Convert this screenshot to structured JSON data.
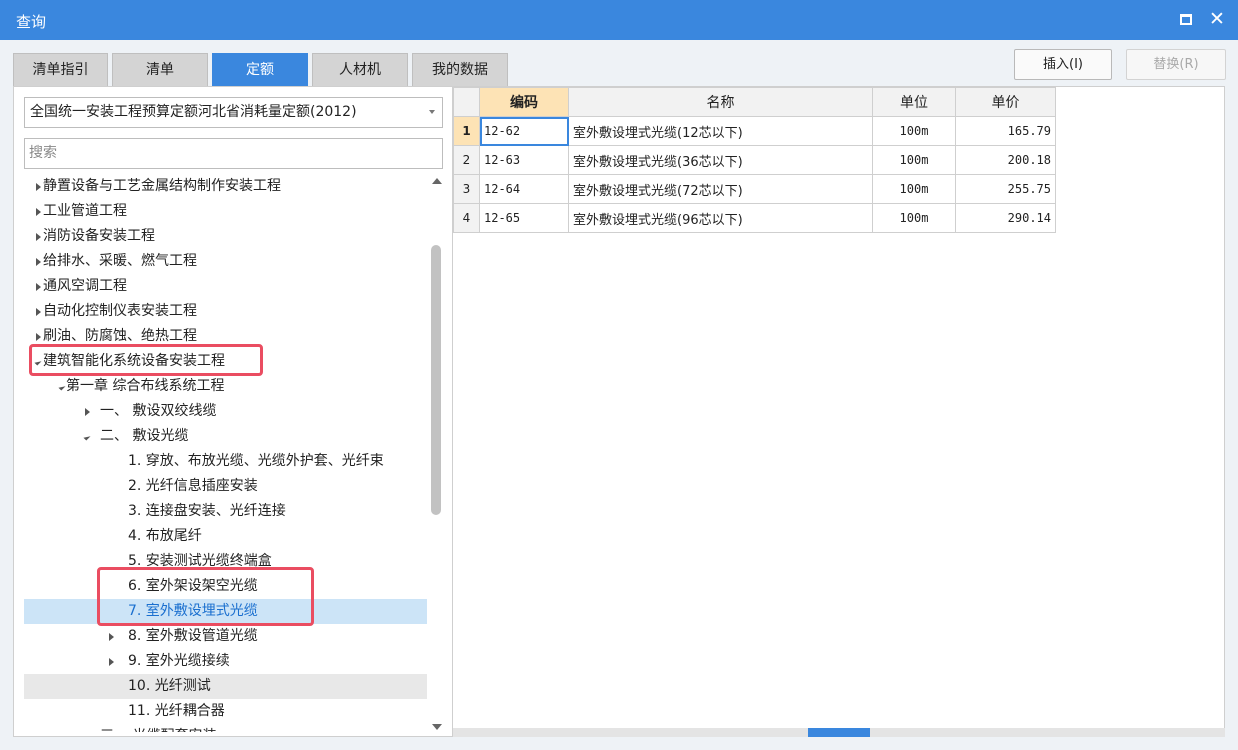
{
  "window": {
    "title": "查询"
  },
  "tabs": [
    {
      "label": "清单指引",
      "active": false
    },
    {
      "label": "清单",
      "active": false
    },
    {
      "label": "定额",
      "active": true
    },
    {
      "label": "人材机",
      "active": false
    },
    {
      "label": "我的数据",
      "active": false
    }
  ],
  "toolbar": {
    "insert_label": "插入(I)",
    "replace_label": "替换(R)"
  },
  "left": {
    "dropdown_value": "全国统一安装工程预算定额河北省消耗量定额(2012)",
    "search_placeholder": "搜索",
    "tree": [
      {
        "label": "静置设备与工艺金属结构制作安装工程",
        "level": 0,
        "expander": "closed"
      },
      {
        "label": "工业管道工程",
        "level": 0,
        "expander": "closed"
      },
      {
        "label": "消防设备安装工程",
        "level": 0,
        "expander": "closed"
      },
      {
        "label": "给排水、采暖、燃气工程",
        "level": 0,
        "expander": "closed"
      },
      {
        "label": "通风空调工程",
        "level": 0,
        "expander": "closed"
      },
      {
        "label": "自动化控制仪表安装工程",
        "level": 0,
        "expander": "closed"
      },
      {
        "label": "刷油、防腐蚀、绝热工程",
        "level": 0,
        "expander": "closed"
      },
      {
        "label": "建筑智能化系统设备安装工程",
        "level": 0,
        "expander": "open"
      },
      {
        "label": "第一章 综合布线系统工程",
        "level": 1,
        "expander": "open"
      },
      {
        "label": "一、 敷设双绞线缆",
        "level": 2,
        "expander": "closed"
      },
      {
        "label": "二、 敷设光缆",
        "level": 2,
        "expander": "open"
      },
      {
        "label": "1. 穿放、布放光缆、光缆外护套、光纤束",
        "level": 3,
        "expander": "none"
      },
      {
        "label": "2. 光纤信息插座安装",
        "level": 3,
        "expander": "none"
      },
      {
        "label": "3. 连接盘安装、光纤连接",
        "level": 3,
        "expander": "none"
      },
      {
        "label": "4. 布放尾纤",
        "level": 3,
        "expander": "none"
      },
      {
        "label": "5. 安装测试光缆终端盒",
        "level": 3,
        "expander": "none"
      },
      {
        "label": "6. 室外架设架空光缆",
        "level": 3,
        "expander": "none"
      },
      {
        "label": "7. 室外敷设埋式光缆",
        "level": 3,
        "expander": "none",
        "selected": true
      },
      {
        "label": "8. 室外敷设管道光缆",
        "level": 3,
        "expander": "closed"
      },
      {
        "label": "9. 室外光缆接续",
        "level": 3,
        "expander": "closed"
      },
      {
        "label": "10. 光纤测试",
        "level": 3,
        "expander": "none",
        "hover": true
      },
      {
        "label": "11. 光纤耦合器",
        "level": 3,
        "expander": "none"
      },
      {
        "label": "三、 光缆配套安装",
        "level": 2,
        "expander": "open"
      }
    ]
  },
  "grid": {
    "columns": [
      "编码",
      "名称",
      "单位",
      "单价"
    ],
    "rows": [
      {
        "num": "1",
        "code": "12-62",
        "name": "室外敷设埋式光缆(12芯以下)",
        "unit": "100m",
        "price": "165.79"
      },
      {
        "num": "2",
        "code": "12-63",
        "name": "室外敷设埋式光缆(36芯以下)",
        "unit": "100m",
        "price": "200.18"
      },
      {
        "num": "3",
        "code": "12-64",
        "name": "室外敷设埋式光缆(72芯以下)",
        "unit": "100m",
        "price": "255.75"
      },
      {
        "num": "4",
        "code": "12-65",
        "name": "室外敷设埋式光缆(96芯以下)",
        "unit": "100m",
        "price": "290.14"
      }
    ]
  },
  "colors": {
    "accent": "#3a87de",
    "annotation": "#ea4d61",
    "selection": "#cce4f7",
    "header_selected": "#fde3b5"
  }
}
